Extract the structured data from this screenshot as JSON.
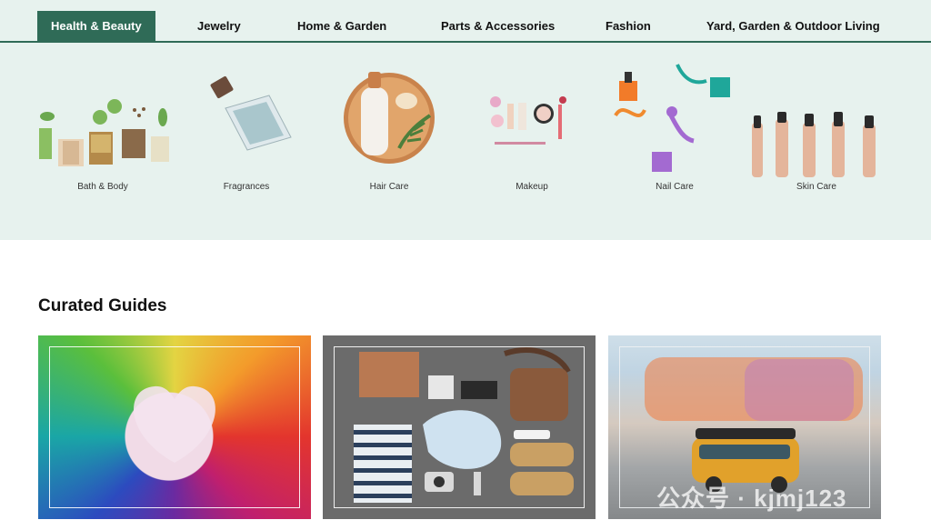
{
  "tabs": [
    {
      "label": "Health & Beauty",
      "active": true
    },
    {
      "label": "Jewelry",
      "active": false
    },
    {
      "label": "Home & Garden",
      "active": false
    },
    {
      "label": "Parts & Accessories",
      "active": false
    },
    {
      "label": "Fashion",
      "active": false
    },
    {
      "label": "Yard, Garden & Outdoor Living",
      "active": false
    }
  ],
  "categories": [
    {
      "label": "Bath & Body",
      "icon": "bath-and-body-products-image"
    },
    {
      "label": "Fragrances",
      "icon": "fragrance-bottle-image"
    },
    {
      "label": "Hair Care",
      "icon": "hair-care-products-image"
    },
    {
      "label": "Makeup",
      "icon": "makeup-products-image"
    },
    {
      "label": "Nail Care",
      "icon": "nail-polish-image"
    },
    {
      "label": "Skin Care",
      "icon": "skin-care-hands-image"
    }
  ],
  "curated": {
    "title": "Curated Guides",
    "guides": [
      {
        "icon": "embroidery-floss-heart-image"
      },
      {
        "icon": "flat-lay-fashion-items-image"
      },
      {
        "icon": "toy-bus-image"
      }
    ]
  },
  "watermark": "公众号 · kjmj123",
  "colors": {
    "accent": "#2f6b57",
    "band": "#e7f2ee"
  }
}
